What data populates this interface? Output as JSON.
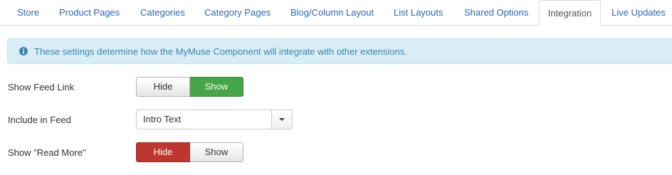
{
  "tabs": [
    {
      "label": "Store"
    },
    {
      "label": "Product Pages"
    },
    {
      "label": "Categories"
    },
    {
      "label": "Category Pages"
    },
    {
      "label": "Blog/Column Layout"
    },
    {
      "label": "List Layouts"
    },
    {
      "label": "Shared Options"
    },
    {
      "label": "Integration",
      "active": true
    },
    {
      "label": "Live Updates"
    }
  ],
  "alert": {
    "icon": "info-circle-icon",
    "message": "These settings determine how the MyMuse Component will integrate with other extensions."
  },
  "fields": {
    "feed_link": {
      "label": "Show Feed Link",
      "option_hide": "Hide",
      "option_show": "Show",
      "selected": "Show"
    },
    "include_in_feed": {
      "label": "Include in Feed",
      "value": "Intro Text"
    },
    "read_more": {
      "label": "Show \"Read More\"",
      "option_hide": "Hide",
      "option_show": "Show",
      "selected": "Hide"
    }
  },
  "colors": {
    "link": "#2a69b8",
    "alert_bg": "#d9edf7",
    "alert_text": "#3a87ad",
    "success": "#46a546",
    "danger": "#bd362f"
  }
}
